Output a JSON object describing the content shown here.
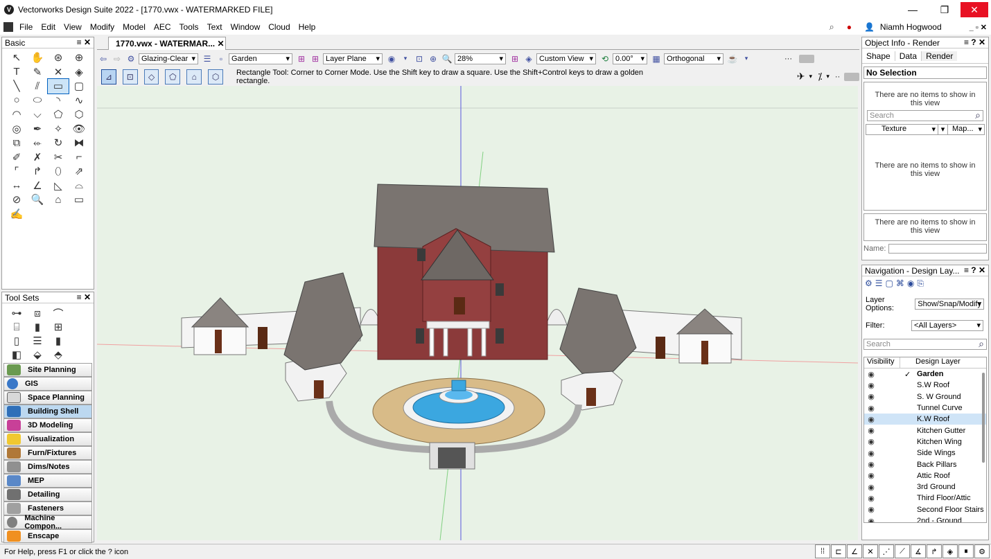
{
  "window": {
    "title": "Vectorworks Design Suite 2022 - [1770.vwx - WATERMARKED FILE]"
  },
  "menu": {
    "items": [
      "File",
      "Edit",
      "View",
      "Modify",
      "Model",
      "AEC",
      "Tools",
      "Text",
      "Window",
      "Cloud",
      "Help"
    ],
    "user": "Niamh Hogwood"
  },
  "basic_palette": {
    "title": "Basic"
  },
  "toolsets_palette": {
    "title": "Tool Sets",
    "sets": [
      "Site Planning",
      "GIS",
      "Space Planning",
      "Building Shell",
      "3D Modeling",
      "Visualization",
      "Furn/Fixtures",
      "Dims/Notes",
      "MEP",
      "Detailing",
      "Fasteners",
      "Machine Compon...",
      "Enscape"
    ],
    "active": "Building Shell"
  },
  "document": {
    "tab": "1770.vwx - WATERMAR..."
  },
  "view_bar": {
    "class": "Glazing-Clear",
    "layer": "Garden",
    "plane": "Layer Plane",
    "zoom": "28%",
    "view": "Custom View",
    "rotation": "0.00°",
    "projection": "Orthogonal"
  },
  "mode_bar": {
    "hint": "Rectangle Tool: Corner to Corner Mode. Use the Shift key to draw a square. Use the Shift+Control keys to draw a golden rectangle."
  },
  "object_info": {
    "title": "Object Info - Render",
    "tabs": [
      "Shape",
      "Data",
      "Render"
    ],
    "selection": "No Selection",
    "empty1": "There are no items to show in this view",
    "search": "Search",
    "texture_col": "Texture",
    "map_col": "Map...",
    "empty2": "There are no items to show in this view",
    "empty3": "There are no items to show in this view",
    "name_label": "Name:"
  },
  "navigation": {
    "title": "Navigation - Design Lay...",
    "layer_options_label": "Layer Options:",
    "layer_options": "Show/Snap/Modify",
    "filter_label": "Filter:",
    "filter": "<All Layers>",
    "search": "Search",
    "col_visibility": "Visibility",
    "col_layer": "Design Layer",
    "layers": [
      "Garden",
      "S.W Roof",
      "S. W Ground",
      "Tunnel Curve",
      "K.W Roof",
      "Kitchen Gutter",
      "Kitchen Wing",
      "Side Wings",
      "Back Pillars",
      "Attic Roof",
      "3rd Ground",
      "Third Floor/Attic",
      "Second Floor Stairs",
      "2nd - Ground"
    ],
    "active_layer": "Garden",
    "selected_layer": "K.W Roof"
  },
  "status": {
    "help": "For Help, press F1 or click the ? icon"
  },
  "colors": {
    "accent": "#0060c0",
    "brick": "#8b3a3a",
    "roof": "#7a7470",
    "water": "#3ba7e0",
    "ground": "#e8f2e6"
  }
}
